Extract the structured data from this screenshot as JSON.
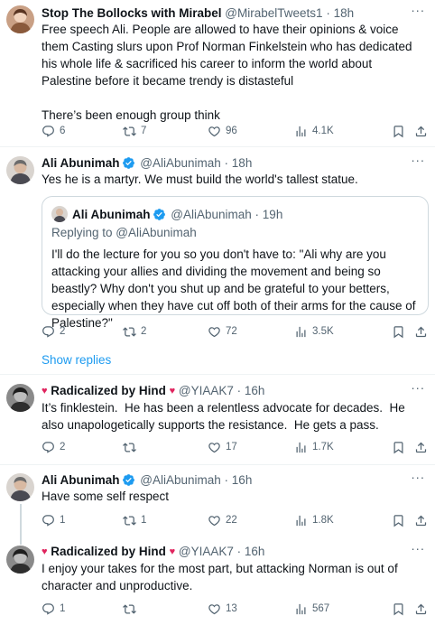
{
  "tweets": [
    {
      "name": "Stop The Bollocks with Mirabel",
      "handle": "@MirabelTweets1",
      "dot": "·",
      "time": "18h",
      "text": "Free speech Ali. People are allowed to have their opinions & voice them Casting slurs upon Prof Norman Finkelstein who has dedicated his whole life & sacrificed his career to inform the world about Palestine before it became trendy is distasteful\n\nThere’s been enough group think",
      "replies": "6",
      "reposts": "7",
      "likes": "96",
      "views": "4.1K"
    },
    {
      "name": "Ali Abunimah",
      "handle": "@AliAbunimah",
      "dot": "·",
      "time": "18h",
      "text": "Yes he is a martyr. We must build the world's tallest statue.",
      "replies": "2",
      "reposts": "2",
      "likes": "72",
      "views": "3.5K",
      "quote": {
        "name": "Ali Abunimah",
        "handle": "@AliAbunimah",
        "dot": "·",
        "time": "19h",
        "replying_prefix": "Replying to ",
        "replying_to": "@AliAbunimah",
        "text": "I'll do the lecture for you so you don't have to: \"Ali why are you attacking your allies and dividing the movement and being so beastly? Why don't you shut up and be grateful to your betters, especially when they have cut off both of their arms for the cause of Palestine?\""
      }
    },
    {
      "name": "Radicalized by Hind",
      "handle": "@YIAAK7",
      "dot": "·",
      "time": "16h",
      "text": "It’s finklestein.  He has been a relentless advocate for decades.  He also unapologetically supports the resistance.  He gets a pass.",
      "replies": "2",
      "reposts": "",
      "likes": "17",
      "views": "1.7K"
    },
    {
      "name": "Ali Abunimah",
      "handle": "@AliAbunimah",
      "dot": "·",
      "time": "16h",
      "text": "Have some self respect",
      "replies": "1",
      "reposts": "1",
      "likes": "22",
      "views": "1.8K"
    },
    {
      "name": "Radicalized by Hind",
      "handle": "@YIAAK7",
      "dot": "·",
      "time": "16h",
      "text": "I enjoy your takes for the most part, but attacking Norman is out of character and unproductive.",
      "replies": "1",
      "reposts": "",
      "likes": "13",
      "views": "567"
    }
  ],
  "show_replies": "Show replies",
  "heart_glyph": "♥",
  "colors": {
    "accent": "#1d9bf0",
    "muted": "#536471",
    "heart": "#e0245e",
    "border": "#eff3f4"
  }
}
